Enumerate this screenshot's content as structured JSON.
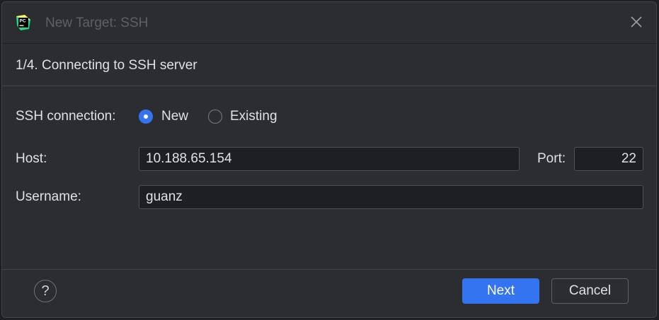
{
  "window": {
    "title": "New Target: SSH",
    "app_icon": "pycharm-icon",
    "close_icon": "close-icon"
  },
  "step": {
    "title": "1/4. Connecting to SSH server"
  },
  "form": {
    "ssh_connection_label": "SSH connection:",
    "options": [
      {
        "label": "New",
        "selected": true
      },
      {
        "label": "Existing",
        "selected": false
      }
    ],
    "host_label": "Host:",
    "host_value": "10.188.65.154",
    "port_label": "Port:",
    "port_value": "22",
    "username_label": "Username:",
    "username_value": "guanz"
  },
  "footer": {
    "help_label": "?",
    "next_label": "Next",
    "cancel_label": "Cancel"
  },
  "colors": {
    "accent": "#3574f0",
    "background": "#2b2d30",
    "text": "#dfe1e5"
  }
}
